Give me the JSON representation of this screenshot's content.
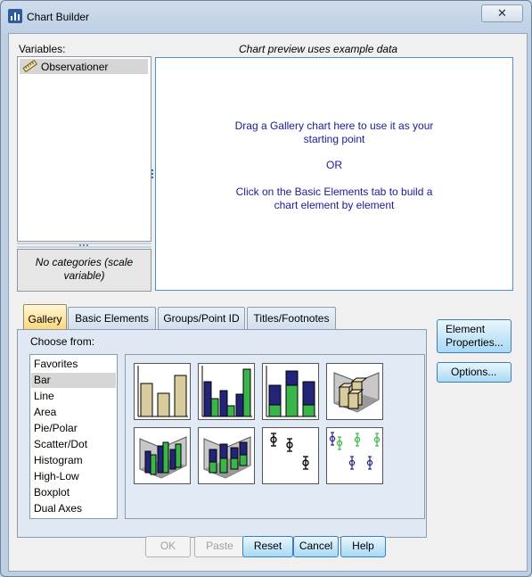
{
  "window": {
    "title": "Chart Builder",
    "close_glyph": "✕"
  },
  "variables": {
    "label": "Variables:",
    "items": [
      {
        "label": "Observationer",
        "icon": "scale-ruler-icon"
      }
    ],
    "categories_note": "No categories (scale variable)"
  },
  "preview": {
    "label": "Chart preview uses example data",
    "line1": "Drag a Gallery chart here to use it as your",
    "line2": "starting point",
    "or": "OR",
    "line3": "Click on the Basic Elements tab to build a",
    "line4": "chart element by element"
  },
  "tabs": [
    {
      "label": "Gallery",
      "active": true
    },
    {
      "label": "Basic Elements",
      "active": false
    },
    {
      "label": "Groups/Point ID",
      "active": false
    },
    {
      "label": "Titles/Footnotes",
      "active": false
    }
  ],
  "gallery": {
    "choose_label": "Choose from:",
    "types": [
      "Favorites",
      "Bar",
      "Line",
      "Area",
      "Pie/Polar",
      "Scatter/Dot",
      "Histogram",
      "High-Low",
      "Boxplot",
      "Dual Axes"
    ],
    "selected": "Bar",
    "thumbnails": [
      "simple-bar-icon",
      "clustered-bar-icon",
      "stacked-bar-icon",
      "3d-bar-icon",
      "3d-clustered-bar-icon",
      "3d-stacked-bar-icon",
      "simple-error-bar-icon",
      "clustered-error-bar-icon"
    ]
  },
  "side_buttons": {
    "element_properties": "Element Properties...",
    "options": "Options..."
  },
  "buttons": {
    "ok": "OK",
    "paste": "Paste",
    "reset": "Reset",
    "cancel": "Cancel",
    "help": "Help"
  },
  "colors": {
    "bar_tan": "#d8cc9c",
    "bar_navy": "#23237a",
    "bar_green": "#3ab54a",
    "accent": "#4f8fd6"
  }
}
